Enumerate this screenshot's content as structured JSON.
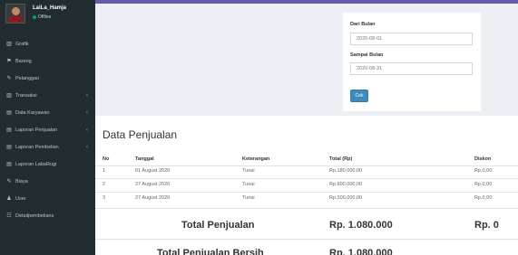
{
  "user": {
    "name": "LaiLa_Hamja",
    "status": "Offline"
  },
  "menu": [
    {
      "label": "Grafik",
      "icon": "bar-chart-icon",
      "glyph": "▥",
      "caret": ""
    },
    {
      "label": "Barang",
      "icon": "tag-icon",
      "glyph": "⚑",
      "caret": ""
    },
    {
      "label": "Pelanggan",
      "icon": "edit-icon",
      "glyph": "✎",
      "caret": ""
    },
    {
      "label": "Transaksi",
      "icon": "bar-chart-icon",
      "glyph": "▥",
      "caret": "‹"
    },
    {
      "label": "Data Karyawan",
      "icon": "book-icon",
      "glyph": "▤",
      "caret": "‹"
    },
    {
      "label": "Laporan Penjualan",
      "icon": "book-icon",
      "glyph": "▤",
      "caret": "‹"
    },
    {
      "label": "Laporan Pembelian",
      "icon": "book-icon",
      "glyph": "▤",
      "caret": "‹"
    },
    {
      "label": "Laporan LabaRugi",
      "icon": "book-icon",
      "glyph": "▤",
      "caret": ""
    },
    {
      "label": "Biaya",
      "icon": "edit-icon",
      "glyph": "✎",
      "caret": ""
    },
    {
      "label": "User",
      "icon": "user-icon",
      "glyph": "♟",
      "caret": ""
    },
    {
      "label": "Detailpembelians",
      "icon": "list-icon",
      "glyph": "☷",
      "caret": ""
    }
  ],
  "filter": {
    "from_label": "Dari Bulan",
    "from_value": "2020-08-01",
    "to_label": "Sampai Bulan",
    "to_value": "2020-08-31",
    "button": "Cek"
  },
  "report": {
    "title": "Data Penjualan",
    "columns": [
      "No",
      "Tanggal",
      "Keterangan",
      "Total (Rp)",
      "Diskon"
    ],
    "rows": [
      [
        "1",
        "01 August 2020",
        "Tunai",
        "Rp.180.000,00",
        "Rp.0,00"
      ],
      [
        "2",
        "27 August 2020",
        "Tunai",
        "Rp.600.000,00",
        "Rp.0,00"
      ],
      [
        "3",
        "27 August 2020",
        "Tunai",
        "Rp.300.000,00",
        "Rp.0,00"
      ]
    ],
    "total_label": "Total Penjualan",
    "total_value": "Rp. 1.080.000",
    "total_discount": "Rp. 0",
    "net_label": "Total Penjualan Bersih",
    "net_value": "Rp. 1.080.000"
  }
}
